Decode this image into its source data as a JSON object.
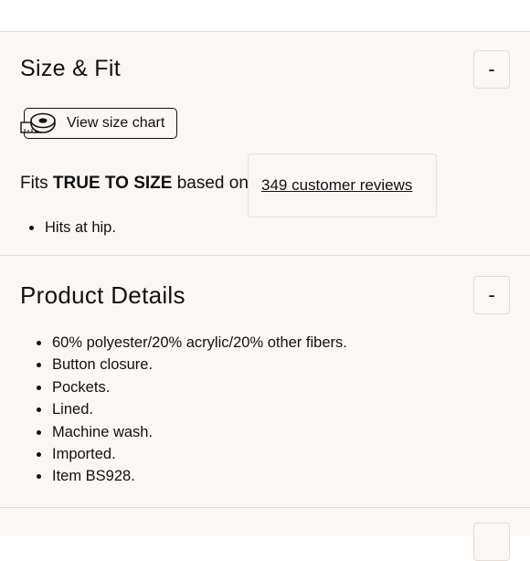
{
  "size_fit": {
    "title": "Size & Fit",
    "toggle_symbol": "-",
    "size_chart_label": "View size chart",
    "fits_prefix": "Fits",
    "fits_value": "TRUE TO SIZE",
    "fits_suffix": "based on",
    "reviews_link": "349 customer reviews",
    "notes": [
      "Hits at hip."
    ]
  },
  "product_details": {
    "title": "Product Details",
    "toggle_symbol": "-",
    "items": [
      "60% polyester/20% acrylic/20% other fibers.",
      "Button closure.",
      "Pockets.",
      "Lined.",
      "Machine wash.",
      "Imported.",
      "Item BS928."
    ]
  },
  "icons": {
    "size_chart": "measuring-tape-icon"
  },
  "colors": {
    "section_bg": "#fbf7f5",
    "divider": "#e2dcd7",
    "text": "#111111"
  }
}
